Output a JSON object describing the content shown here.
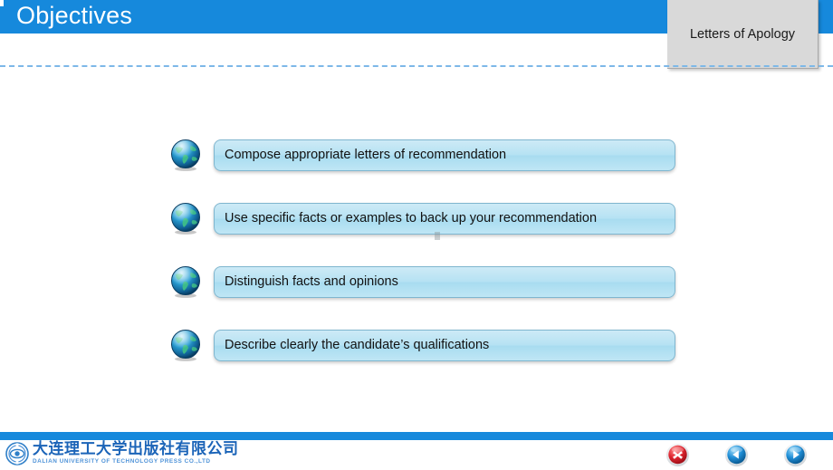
{
  "slide": {
    "header": {
      "title": "Objectives",
      "bar_color": "#1689dc"
    },
    "section_tab": {
      "label": "Letters of Apology",
      "background_color": "#d9d9d9"
    },
    "divider": {
      "style": "dashed",
      "color": "#7db8e8"
    },
    "objectives": [
      {
        "icon": "globe-icon",
        "text": "Compose appropriate letters of recommendation"
      },
      {
        "icon": "globe-icon",
        "text": "Use specific facts or examples to back up your recommendation"
      },
      {
        "icon": "globe-icon",
        "text": "Distinguish facts and opinions"
      },
      {
        "icon": "globe-icon",
        "text": "Describe clearly the candidate’s qualifications"
      }
    ],
    "footer": {
      "bar_color": "#1689dc",
      "publisher": {
        "logo_icon": "eye-circle-logo-icon",
        "name_cn": "大连理工大学出版社有限公司",
        "name_en": "DALIAN UNIVERSITY OF TECHNOLOGY PRESS CO.,LTD",
        "cn_color": "#1b64b8",
        "en_color": "#4f93d8"
      },
      "nav_buttons": [
        {
          "name": "close",
          "icon": "close-x-icon",
          "color": "#d81f2a"
        },
        {
          "name": "previous",
          "icon": "arrow-left-icon",
          "color": "#1f8fd8"
        },
        {
          "name": "next",
          "icon": "arrow-right-icon",
          "color": "#1f8fd8"
        }
      ]
    }
  }
}
